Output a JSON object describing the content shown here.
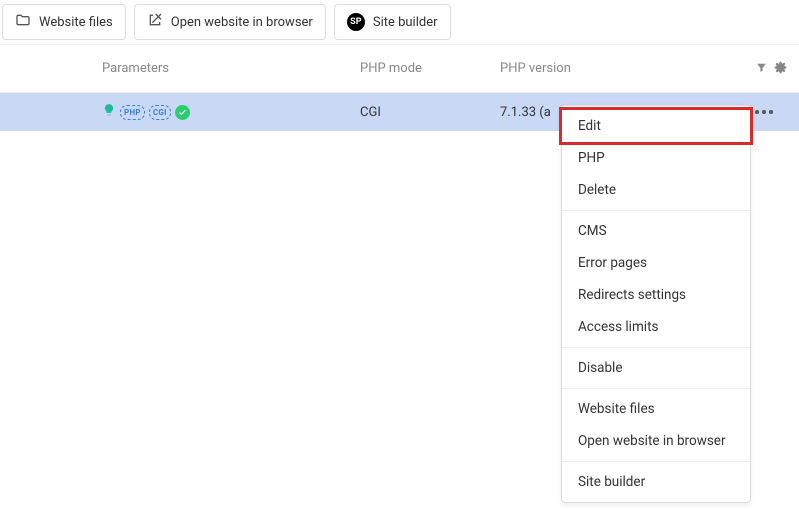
{
  "toolbar": {
    "website_files": "Website files",
    "open_in_browser": "Open website in browser",
    "site_builder": "Site builder",
    "sp_badge": "SP"
  },
  "table": {
    "headers": {
      "parameters": "Parameters",
      "php_mode": "PHP mode",
      "php_version": "PHP version"
    },
    "row": {
      "php_pill": "PHP",
      "cgi_pill": "CGI",
      "mode": "CGI",
      "version": "7.1.33 (a"
    }
  },
  "menu": {
    "edit": "Edit",
    "php": "PHP",
    "delete": "Delete",
    "cms": "CMS",
    "error_pages": "Error pages",
    "redirects": "Redirects settings",
    "access_limits": "Access limits",
    "disable": "Disable",
    "website_files": "Website files",
    "open_in_browser": "Open website in browser",
    "site_builder": "Site builder"
  }
}
